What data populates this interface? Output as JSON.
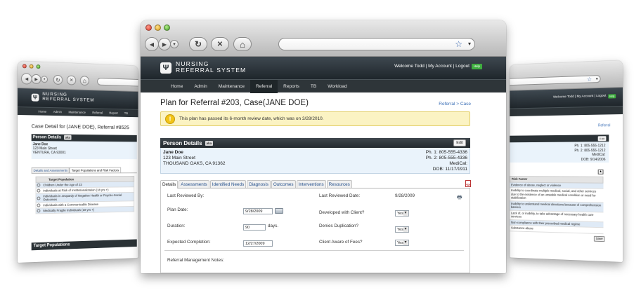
{
  "main": {
    "nav_buttons": {
      "back": "◀",
      "forward": "▶",
      "dropdown": "▾",
      "reload": "↻",
      "stop": "✕",
      "home": "⌂",
      "star": "☆",
      "url_dropdown": "▾"
    },
    "brand": {
      "line1": "Nursing",
      "line2": "Referral System"
    },
    "header": {
      "welcome": "Welcome Todd",
      "sep1": "|",
      "my_account": "My Account",
      "sep2": "|",
      "logout": "Logout",
      "help": "Help"
    },
    "nav": [
      "Home",
      "Admin",
      "Maintenance",
      "Referral",
      "Reports",
      "TB",
      "Workload"
    ],
    "page_title": "Plan for Referral #203, Case(JANE DOE)",
    "breadcrumb": "Referral > Case",
    "warning": {
      "icon": "!",
      "text": "This plan has passed its 6-month review date, which was on 3/28/2010."
    },
    "person": {
      "section_title": "Person Details",
      "aka_label": "aka",
      "edit_label": "Edit",
      "name": "Jane Doe",
      "street": "123 Main Street",
      "city": "THOUSAND OAKS, CA 91362",
      "phone1": "Ph. 1: 805-555-4336",
      "phone2": "Ph. 2: 805-555-4336",
      "medical": "MediCal:",
      "dob": "DOB: 11/17/1911"
    },
    "tabs": [
      "Details",
      "Assessments",
      "Identified Needs",
      "Diagnosis",
      "Outcomes",
      "Interventions",
      "Resources"
    ],
    "pdf_label": "PDF",
    "form": {
      "last_reviewed_by": "Last Reviewed By:",
      "last_reviewed_date_label": "Last Reviewed Date:",
      "last_reviewed_date_value": "9/28/2009",
      "print_icon": "🖶",
      "plan_date_label": "Plan Date:",
      "plan_date_value": "9/28/2009",
      "developed_label": "Developed with Client?",
      "developed_value": "Yes",
      "duration_label": "Duration:",
      "duration_value": "90",
      "duration_unit": "days.",
      "denies_label": "Denies Duplication?",
      "denies_value": "Yes",
      "expected_label": "Expected Completion:",
      "expected_value": "12/27/2009",
      "fees_label": "Client Aware of Fees?",
      "fees_value": "Yes",
      "notes_label": "Referral Management Notes:"
    }
  },
  "left": {
    "nav_buttons": {
      "back": "◀",
      "forward": "▶",
      "dropdown": "▾",
      "reload": "↻",
      "stop": "✕",
      "home": "⌂"
    },
    "brand": {
      "line1": "Nursing",
      "line2": "Referral System"
    },
    "nav": [
      "Home",
      "Admin",
      "Maintenance",
      "Referral",
      "Report",
      "TB"
    ],
    "title": "Case Detail for (JANE DOE), Referral #8525",
    "person_title": "Person Details",
    "aka_label": "aka",
    "name": "Jane Doe",
    "street": "123 Main Street",
    "city": "VENTURA, CA 93001",
    "tabs": [
      "Details and Assessments",
      "Target Populations and Risk Factors"
    ],
    "target_header": "Target Population",
    "targets": [
      "Children Under the Age of 23",
      "Individuals at Risk of Institutionalization (18 yrs +)",
      "Individuals in Jeopardy of Negative Health or Psycho-Social Outcomes",
      "Individuals with a Communicable Disease",
      "Medically Fragile Individuals (18 yrs +)"
    ],
    "bottom_title": "Target Populations"
  },
  "right": {
    "star": "☆",
    "url_dropdown": "▾",
    "header": {
      "welcome": "Welcome Todd",
      "sep1": "|",
      "my_account": "My Account",
      "sep2": "|",
      "logout": "Logout",
      "help": "Help"
    },
    "breadcrumb": "Referral",
    "edit_label": "Edit",
    "phone1": "Ph. 1: 805-555-1212",
    "phone2": "Ph. 2: 805-555-1212",
    "medical": "MediCal:",
    "dob": "DOB: 9/14/2006",
    "risk_header": "Risk Factor",
    "risks": [
      "Evidence of abuse, neglect or violence",
      "Inability to coordinate multiple medical, social, and other services due to the existence of an unstable medical condition or need for stabilization",
      "Inability to understand medical directions because of comprehension barriers",
      "Lack of, or inability, to take advantage of necessary health care services",
      "Non-compliance with their prescribed medical regime",
      "Substance abuse"
    ],
    "save_label": "Save"
  }
}
